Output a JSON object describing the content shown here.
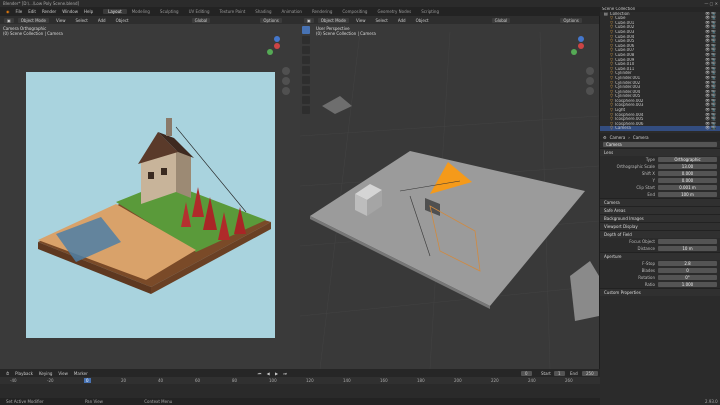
{
  "title": "Blender* [D:\\...\\Low Poly Scene.blend]",
  "menubar": {
    "menus": [
      "File",
      "Edit",
      "Render",
      "Window",
      "Help"
    ],
    "workspaces": [
      "Layout",
      "Modeling",
      "Sculpting",
      "UV Editing",
      "Texture Paint",
      "Shading",
      "Animation",
      "Rendering",
      "Compositing",
      "Geometry Nodes",
      "Scripting"
    ],
    "active_workspace": "Layout",
    "scene": "Scene",
    "view_layer": "View Layer"
  },
  "left_view": {
    "mode": "Object Mode",
    "menus": [
      "View",
      "Select",
      "Add",
      "Object"
    ],
    "orientation": "Global",
    "options": "Options",
    "overlay_line1": "Camera Orthographic",
    "overlay_line2": "(0) Scene Collection | Camera"
  },
  "right_view": {
    "mode": "Object Mode",
    "menus": [
      "View",
      "Select",
      "Add",
      "Object"
    ],
    "orientation": "Global",
    "options": "Options",
    "overlay_line1": "User Perspective",
    "overlay_line2": "(0) Scene Collection | Camera"
  },
  "outliner": {
    "header": "Scene Collection",
    "rows": [
      {
        "name": "Collection",
        "selected": false
      },
      {
        "name": "Cube",
        "selected": false
      },
      {
        "name": "Cube.001",
        "selected": false
      },
      {
        "name": "Cube.002",
        "selected": false
      },
      {
        "name": "Cube.003",
        "selected": false
      },
      {
        "name": "Cube.004",
        "selected": false
      },
      {
        "name": "Cube.005",
        "selected": false
      },
      {
        "name": "Cube.006",
        "selected": false
      },
      {
        "name": "Cube.007",
        "selected": false
      },
      {
        "name": "Cube.008",
        "selected": false
      },
      {
        "name": "Cube.009",
        "selected": false
      },
      {
        "name": "Cube.010",
        "selected": false
      },
      {
        "name": "Cube.011",
        "selected": false
      },
      {
        "name": "Cylinder",
        "selected": false
      },
      {
        "name": "Cylinder.001",
        "selected": false
      },
      {
        "name": "Cylinder.002",
        "selected": false
      },
      {
        "name": "Cylinder.003",
        "selected": false
      },
      {
        "name": "Cylinder.004",
        "selected": false
      },
      {
        "name": "Cylinder.005",
        "selected": false
      },
      {
        "name": "Icosphere.002",
        "selected": false
      },
      {
        "name": "Icosphere.003",
        "selected": false
      },
      {
        "name": "Light",
        "selected": false
      },
      {
        "name": "Icosphere.004",
        "selected": false
      },
      {
        "name": "Icosphere.005",
        "selected": false
      },
      {
        "name": "Icosphere.006",
        "selected": false
      },
      {
        "name": "Camera",
        "selected": true
      }
    ]
  },
  "properties": {
    "breadcrumb": [
      "Camera",
      "Camera"
    ],
    "datablock": "Camera",
    "lens_section": "Lens",
    "type_label": "Type",
    "type_value": "Orthographic",
    "ortho_label": "Orthographic Scale",
    "ortho_value": "13.00",
    "shiftx_label": "Shift X",
    "shiftx_value": "0.000",
    "shifty_label": "Y",
    "shifty_value": "0.000",
    "clipstart_label": "Clip Start",
    "clipstart_value": "0.001 m",
    "clipend_label": "End",
    "clipend_value": "100 m",
    "sections": [
      "Camera",
      "Safe Areas",
      "Background Images",
      "Viewport Display",
      "Depth of Field"
    ],
    "focus_label": "Focus Object",
    "distance_label": "Distance",
    "distance_value": "10 m",
    "aperture_section": "Aperture",
    "fstop_label": "F-Stop",
    "fstop_value": "2.8",
    "blades_label": "Blades",
    "blades_value": "0",
    "rotation_label": "Rotation",
    "rotation_value": "0°",
    "ratio_label": "Ratio",
    "ratio_value": "1.000",
    "custom_section": "Custom Properties"
  },
  "timeline": {
    "menus": [
      "Playback",
      "Keying",
      "View",
      "Marker"
    ],
    "current_frame": "0",
    "start_label": "Start",
    "start_value": "1",
    "end_label": "End",
    "end_value": "250",
    "ticks": [
      "-40",
      "-20",
      "0",
      "20",
      "40",
      "60",
      "80",
      "100",
      "120",
      "140",
      "160",
      "180",
      "200",
      "220",
      "240",
      "260"
    ]
  },
  "statusbar": [
    "Set Active Modifier",
    "Pan View",
    "Context Menu"
  ],
  "version": "2.93.0",
  "colors": {
    "accent": "#4772b3",
    "camera_cone": "#f59a1a",
    "sky": "#a9d3de"
  }
}
